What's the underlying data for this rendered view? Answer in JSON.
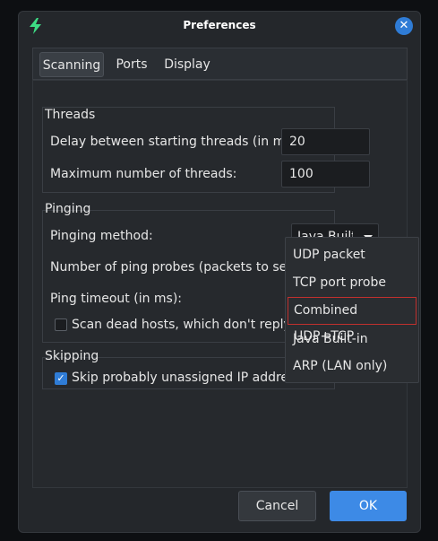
{
  "window": {
    "title": "Preferences",
    "app_icon": "lightning-icon",
    "close_icon": "close-icon"
  },
  "tabs": [
    {
      "label": "Scanning",
      "active": true
    },
    {
      "label": "Ports",
      "active": false
    },
    {
      "label": "Display",
      "active": false
    }
  ],
  "threads": {
    "title": "Threads",
    "delay_label": "Delay between starting threads (in ms):",
    "delay_value": "20",
    "max_label": "Maximum number of threads:",
    "max_value": "100"
  },
  "pinging": {
    "title": "Pinging",
    "method_label": "Pinging method:",
    "method_value": "Java Built-in",
    "probes_label": "Number of ping probes (packets to send):",
    "timeout_label": "Ping timeout (in ms):",
    "scan_dead_label": "Scan dead hosts, which don't reply to",
    "scan_dead_checked": false
  },
  "skipping": {
    "title": "Skipping",
    "skip_label": "Skip probably unassigned IP addresses",
    "skip_checked": true
  },
  "dropdown": {
    "options": [
      "UDP packet",
      "TCP port probe",
      "Combined UDP+TCP",
      "Java Built-in",
      "ARP (LAN only)"
    ],
    "highlighted": "Combined UDP+TCP"
  },
  "buttons": {
    "cancel": "Cancel",
    "ok": "OK"
  },
  "colors": {
    "accent": "#3d8ae6",
    "highlight_border": "#c0302e",
    "icon_green": "#3ddc84"
  }
}
